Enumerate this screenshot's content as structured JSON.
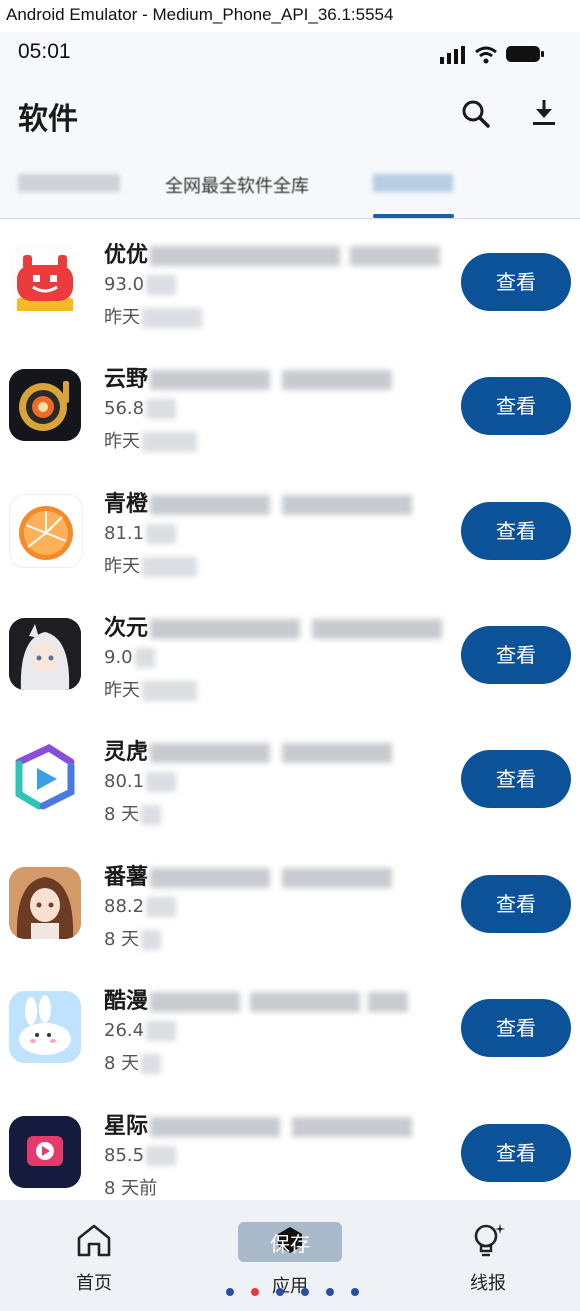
{
  "window": {
    "title": "Android Emulator - Medium_Phone_API_36.1:5554"
  },
  "status_bar": {
    "time": "05:01"
  },
  "app_bar": {
    "title": "软件"
  },
  "tabs": [
    {
      "label": ""
    },
    {
      "label": "全网最全软件全库"
    },
    {
      "label": ""
    }
  ],
  "apps": [
    {
      "name": "优优",
      "size": "93.0",
      "date": "昨天",
      "button": "查看",
      "icon": "red-face-icon"
    },
    {
      "name": "云野",
      "size": "56.8",
      "date": "昨天",
      "button": "查看",
      "icon": "gold-record-icon"
    },
    {
      "name": "青橙",
      "size": "81.1",
      "date": "昨天",
      "button": "查看",
      "icon": "orange-icon"
    },
    {
      "name": "次元",
      "size": "9.0",
      "date": "昨天",
      "button": "查看",
      "icon": "anime-girl-icon"
    },
    {
      "name": "灵虎",
      "size": "80.1",
      "date": "8 天",
      "button": "查看",
      "icon": "play-prism-icon"
    },
    {
      "name": "番薯",
      "size": "88.2",
      "date": "8 天",
      "button": "查看",
      "icon": "anime-portrait-icon"
    },
    {
      "name": "酷漫",
      "size": "26.4",
      "date": "8 天",
      "button": "查看",
      "icon": "bunny-icon"
    },
    {
      "name": "星际",
      "size": "85.5",
      "date": "8 天前",
      "button": "查看",
      "icon": "video-play-icon"
    }
  ],
  "bottom_nav": {
    "home": "首页",
    "apps": "应用",
    "news": "线报",
    "overlay": "保存"
  },
  "colors": {
    "accent": "#0c5299",
    "tab_indicator": "#1a5fa8"
  }
}
